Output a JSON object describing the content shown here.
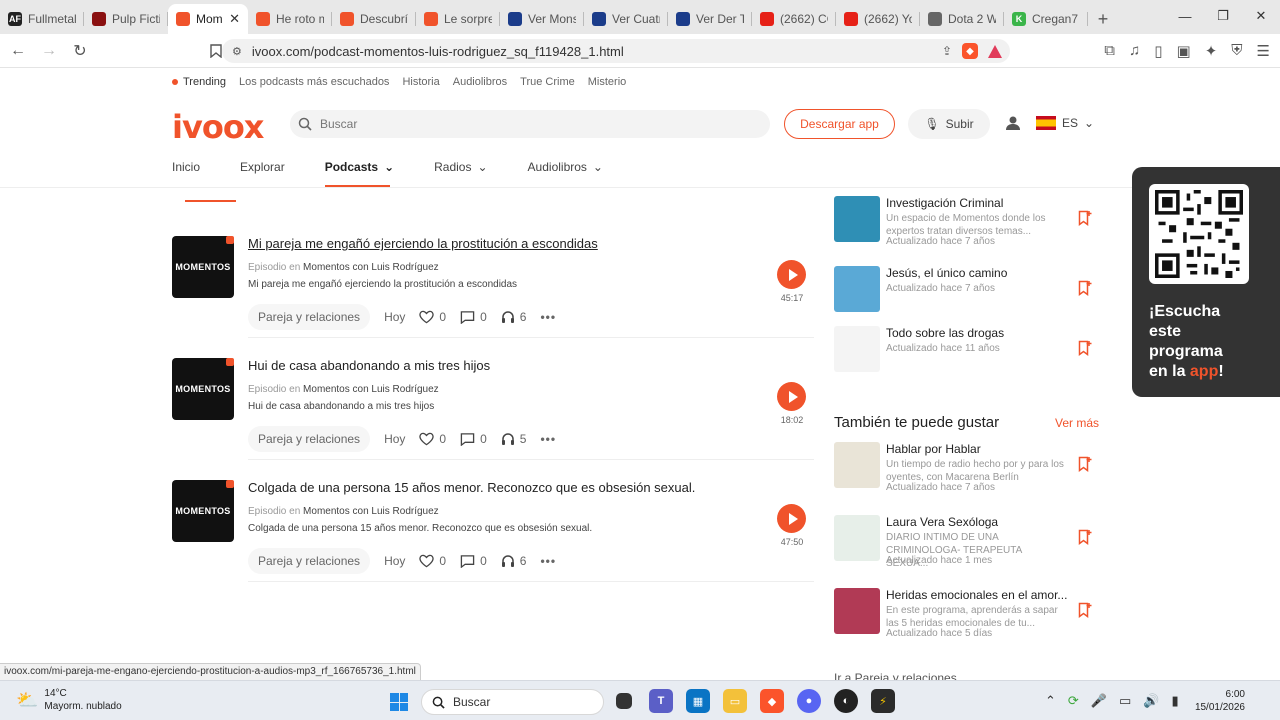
{
  "browser": {
    "tabs": [
      {
        "label": "Fullmetal",
        "color": "#222",
        "glyph": "AF"
      },
      {
        "label": "Pulp Fiction",
        "color": "#8a1010",
        "glyph": ""
      },
      {
        "label": "Mom",
        "color": "#f0532b",
        "glyph": "",
        "active": true
      },
      {
        "label": "He roto m",
        "color": "#f0532b",
        "glyph": ""
      },
      {
        "label": "Descubrí",
        "color": "#f0532b",
        "glyph": ""
      },
      {
        "label": "Le sorpre",
        "color": "#f0532b",
        "glyph": ""
      },
      {
        "label": "Ver Mons",
        "color": "#1b3c8a",
        "glyph": ""
      },
      {
        "label": "Ver Cuatr",
        "color": "#1b3c8a",
        "glyph": ""
      },
      {
        "label": "Ver Der T",
        "color": "#1b3c8a",
        "glyph": ""
      },
      {
        "label": "(2662) CO",
        "color": "#e62117",
        "glyph": ""
      },
      {
        "label": "(2662) Yo",
        "color": "#e62117",
        "glyph": ""
      },
      {
        "label": "Dota 2 W",
        "color": "#666",
        "glyph": ""
      },
      {
        "label": "Cregan7",
        "color": "#3bb54a",
        "glyph": "K"
      }
    ],
    "url": "ivoox.com/podcast-momentos-luis-rodriguez_sq_f119428_1.html",
    "status_url": "ivoox.com/mi-pareja-me-engano-ejerciendo-prostitucion-a-audios-mp3_rf_166765736_1.html"
  },
  "site": {
    "topnav": {
      "trending": "Trending",
      "links": [
        "Los podcasts más escuchados",
        "Historia",
        "Audiolibros",
        "True Crime",
        "Misterio"
      ]
    },
    "logo": "ivoox",
    "search_placeholder": "Buscar",
    "download_label": "Descargar app",
    "upload_label": "Subir",
    "lang": "ES",
    "mainnav": {
      "inicio": "Inicio",
      "explorar": "Explorar",
      "podcasts": "Podcasts",
      "radios": "Radios",
      "audiolibros": "Audiolibros"
    }
  },
  "episodes": [
    {
      "title": "Mi pareja me engañó ejerciendo la prostitución a escondidas",
      "meta_prefix": "Episodio en",
      "podcast": "Momentos con Luis Rodríguez",
      "desc": "Mi pareja me engañó ejerciendo la prostitución a escondidas",
      "tag": "Pareja y relaciones",
      "date": "Hoy",
      "likes": "0",
      "comments": "0",
      "listens": "6",
      "duration": "45:17",
      "cover": "MOMENTOS"
    },
    {
      "title": "Hui de casa abandonando a mis tres hijos",
      "meta_prefix": "Episodio en",
      "podcast": "Momentos con Luis Rodríguez",
      "desc": "Hui de casa abandonando a mis tres hijos",
      "tag": "Pareja y relaciones",
      "date": "Hoy",
      "likes": "0",
      "comments": "0",
      "listens": "5",
      "duration": "18:02",
      "cover": "MOMENTOS"
    },
    {
      "title": "Colgada de una persona 15 años menor. Reconozco que es obsesión sexual.",
      "meta_prefix": "Episodio en",
      "podcast": "Momentos con Luis Rodríguez",
      "desc": "Colgada de una persona 15 años menor. Reconozco que es obsesión sexual.",
      "tag": "Pareja y relaciones",
      "date": "Hoy",
      "likes": "0",
      "comments": "0",
      "listens": "6",
      "duration": "47:50",
      "cover": "MOMENTOS"
    }
  ],
  "sidebar_top": [
    {
      "title": "Investigación Criminal",
      "desc": "Un espacio de Momentos donde los expertos tratan diversos temas...",
      "updated": "Actualizado hace 7 años",
      "thumb": "#2f8fb5"
    },
    {
      "title": "Jesús, el único camino",
      "desc": "",
      "updated": "Actualizado hace 7 años",
      "thumb": "#5aa9d6"
    },
    {
      "title": "Todo sobre las drogas",
      "desc": "",
      "updated": "Actualizado hace 11 años",
      "thumb": "#f4f4f4"
    }
  ],
  "also_like": {
    "heading": "También te puede gustar",
    "see_more": "Ver más",
    "items": [
      {
        "title": "Hablar por Hablar",
        "desc": "Un tiempo de radio hecho por y para los oyentes, con Macarena Berlín",
        "updated": "Actualizado hace 7 años",
        "thumb": "#e9e4d7"
      },
      {
        "title": "Laura Vera Sexóloga",
        "desc": "DIARIO INTIMO DE UNA CRIMINOLOGA- TERAPEUTA SEXUA...",
        "updated": "Actualizado hace 1 mes",
        "thumb": "#e7efe9"
      },
      {
        "title": "Heridas emocionales en el amor...",
        "desc": "En este programa, aprenderás a sapar las 5 heridas emocionales de tu...",
        "updated": "Actualizado hace 5 días",
        "thumb": "#b13a55"
      }
    ]
  },
  "qr_card": {
    "line1": "¡Escucha",
    "line2": "este",
    "line3": "programa",
    "line4_prefix": "en la ",
    "line4_app": "app",
    "line4_suffix": "!"
  },
  "truncated_link": "Ir a Pareja y relaciones",
  "taskbar": {
    "temp": "14°C",
    "weather": "Mayorm. nublado",
    "search": "Buscar",
    "time": "6:00",
    "date": "15/01/2026"
  },
  "colors": {
    "accent": "#f0532b"
  }
}
